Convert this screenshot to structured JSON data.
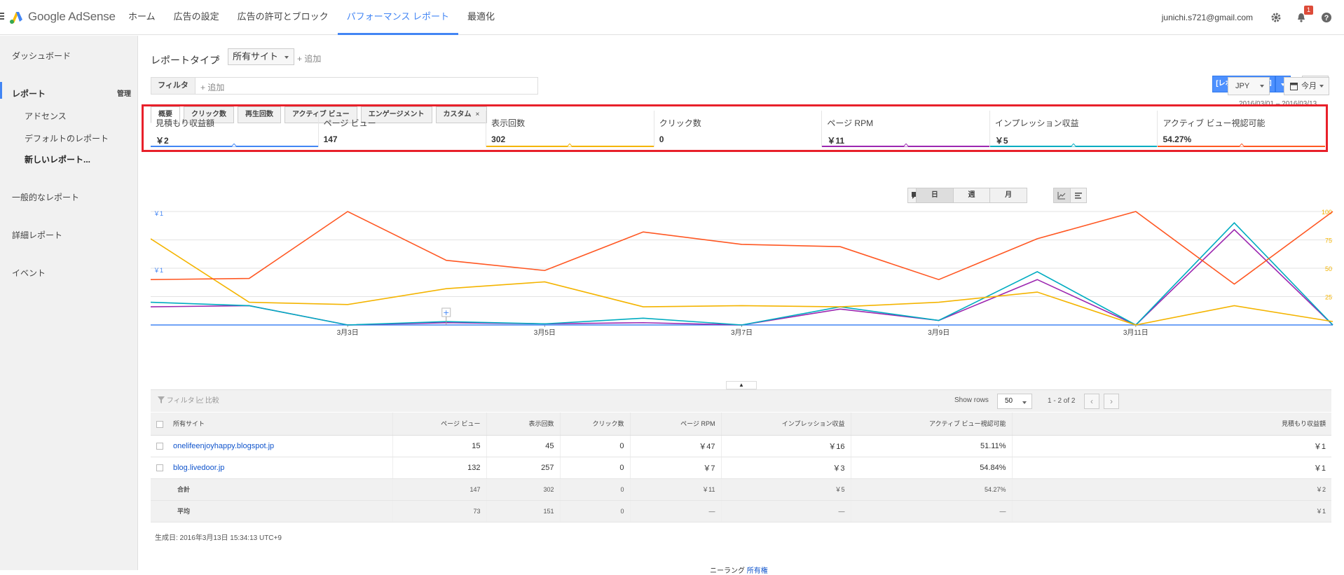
{
  "app": {
    "logo_text": "Google AdSense"
  },
  "nav": {
    "items": [
      "ホーム",
      "広告の設定",
      "広告の許可とブロック",
      "パフォーマンス レポート",
      "最適化"
    ],
    "active_index": 3
  },
  "account": {
    "email": "junichi.s721@gmail.com",
    "notification_count": "1"
  },
  "sidebar": {
    "dashboard": "ダッシュボード",
    "report": "レポート",
    "manage": "管理",
    "sub": [
      "アドセンス",
      "デフォルトのレポート",
      "新しいレポート..."
    ],
    "general": "一般的なレポート",
    "detailed": "詳細レポート",
    "events": "イベント"
  },
  "report": {
    "type_label": "レポートタイプ",
    "separator": "›",
    "site_select": "所有サイト",
    "add": "+ 追加",
    "filter_label": "フィルタ",
    "filter_add": "+ 追加",
    "add_button": "[レポート] に追加",
    "currency": "JPY",
    "period": "今月",
    "date_range": "2016/03/01 – 2016/03/13"
  },
  "tabs": [
    "概要",
    "クリック数",
    "再生回数",
    "アクティブ ビュー",
    "エンゲージメント",
    "カスタム"
  ],
  "tab_close": "×",
  "metrics": [
    {
      "label": "見積もり収益額",
      "value": "￥2",
      "color": "#4285f4"
    },
    {
      "label": "ページ ビュー",
      "value": "147",
      "color": "#ffffff"
    },
    {
      "label": "表示回数",
      "value": "302",
      "color": "#f4b400"
    },
    {
      "label": "クリック数",
      "value": "0",
      "color": "#ffffff"
    },
    {
      "label": "ページ RPM",
      "value": "￥11",
      "color": "#9c27b0"
    },
    {
      "label": "インプレッション収益",
      "value": "￥5",
      "color": "#00acc1"
    },
    {
      "label": "アクティブ ビュー視認可能",
      "value": "54.27%",
      "color": "#ff5722"
    }
  ],
  "chart_toolbar": {
    "day": "日",
    "week": "週",
    "month": "月"
  },
  "chart_data": {
    "type": "line",
    "x": [
      "3月1日",
      "3月2日",
      "3月3日",
      "3月4日",
      "3月5日",
      "3月6日",
      "3月7日",
      "3月8日",
      "3月9日",
      "3月10日",
      "3月11日",
      "3月12日",
      "3月13日"
    ],
    "x_tick_labels": [
      "3月3日",
      "3月5日",
      "3月7日",
      "3月9日",
      "3月11日"
    ],
    "left_tick_labels": [
      "￥1",
      "￥1"
    ],
    "right_tick_labels": [
      "100",
      "75",
      "50",
      "25"
    ],
    "right_ylim": [
      0,
      100
    ],
    "series": [
      {
        "name": "アクティブ ビュー視認可能",
        "color": "#ff5722",
        "values": [
          40,
          41,
          100,
          57,
          48,
          82,
          71,
          69,
          40,
          76,
          100,
          36,
          100
        ]
      },
      {
        "name": "表示回数",
        "color": "#f4b400",
        "values": [
          76,
          20,
          18,
          32,
          38,
          16,
          17,
          16,
          20,
          29,
          0,
          17,
          3
        ]
      },
      {
        "name": "インプレッション収益",
        "color": "#00acc1",
        "values": [
          20,
          17,
          0,
          3,
          1,
          6,
          0,
          16,
          4,
          47,
          0,
          90,
          0
        ]
      },
      {
        "name": "ページ RPM",
        "color": "#9c27b0",
        "values": [
          16,
          17,
          0,
          2,
          1,
          2,
          0,
          14,
          4,
          40,
          0,
          84,
          0
        ]
      },
      {
        "name": "見積もり収益額",
        "color": "#4285f4",
        "values": [
          0,
          0,
          0,
          0,
          0,
          0,
          0,
          0,
          0,
          0,
          0,
          0,
          0
        ]
      }
    ]
  },
  "table_toolbar": {
    "filter": "フィルタ",
    "compare": "比較",
    "show_rows_label": "Show rows",
    "rows": "50",
    "page_info": "1 - 2 of 2"
  },
  "table": {
    "headers": [
      "所有サイト",
      "ページ ビュー",
      "表示回数",
      "クリック数",
      "ページ RPM",
      "インプレッション収益",
      "アクティブ ビュー視認可能",
      "見積もり収益額"
    ],
    "rows": [
      [
        "onelifeenjoyhappy.blogspot.jp",
        "15",
        "45",
        "0",
        "￥47",
        "￥16",
        "51.11%",
        "￥1"
      ],
      [
        "blog.livedoor.jp",
        "132",
        "257",
        "0",
        "￥7",
        "￥3",
        "54.84%",
        "￥1"
      ]
    ],
    "total": [
      "合計",
      "147",
      "302",
      "0",
      "￥11",
      "￥5",
      "54.27%",
      "￥2"
    ],
    "average": [
      "平均",
      "73",
      "151",
      "0",
      "—",
      "—",
      "—",
      "￥1"
    ]
  },
  "generated": "生成日: 2016年3月13日 15:34:13 UTC+9",
  "footer_partial": {
    "text": "ニーラング ",
    "link": "所有権"
  }
}
